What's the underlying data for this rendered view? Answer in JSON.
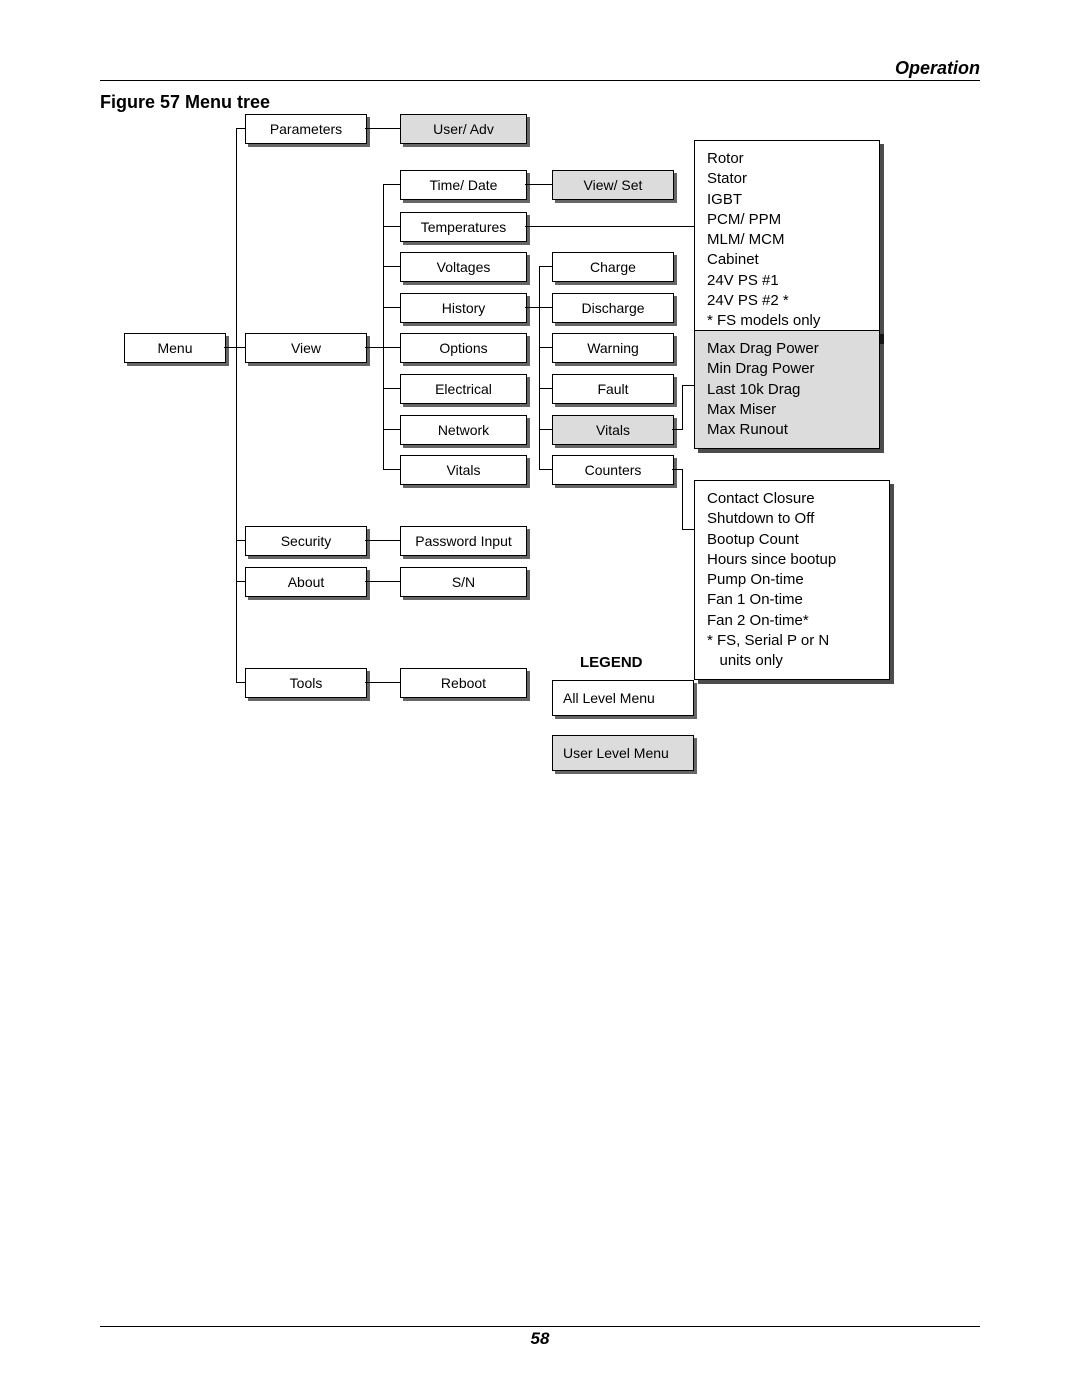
{
  "header": "Operation",
  "figure_label": "Figure 57  Menu tree",
  "page_number": "58",
  "menu": "Menu",
  "level1": {
    "parameters": "Parameters",
    "view": "View",
    "security": "Security",
    "about": "About",
    "tools": "Tools"
  },
  "level2": {
    "user_adv": "User/ Adv",
    "time_date": "Time/ Date",
    "temperatures": "Temperatures",
    "voltages": "Voltages",
    "history": "History",
    "options": "Options",
    "electrical": "Electrical",
    "network": "Network",
    "vitals": "Vitals",
    "password_input": "Password Input",
    "sn": "S/N",
    "reboot": "Reboot"
  },
  "level3": {
    "view_set": "View/ Set",
    "charge": "Charge",
    "discharge": "Discharge",
    "warning": "Warning",
    "fault": "Fault",
    "vitals": "Vitals",
    "counters": "Counters"
  },
  "temps_panel": [
    "Rotor",
    "Stator",
    "IGBT",
    "PCM/ PPM",
    "MLM/ MCM",
    "Cabinet",
    "24V PS #1",
    "24V PS #2 *",
    "*  FS models only"
  ],
  "vitals_panel": [
    "Max Drag Power",
    "Min Drag Power",
    "Last 10k Drag",
    "Max Miser",
    "Max Runout"
  ],
  "counters_panel": [
    "Contact Closure",
    "Shutdown to Off",
    "Bootup Count",
    "Hours since bootup",
    "Pump On-time",
    "Fan 1 On-time",
    "Fan 2 On-time*",
    "*  FS, Serial P or N",
    "   units only"
  ],
  "legend": {
    "title": "LEGEND",
    "all_level": "All Level Menu",
    "user_level": "User Level Menu"
  }
}
